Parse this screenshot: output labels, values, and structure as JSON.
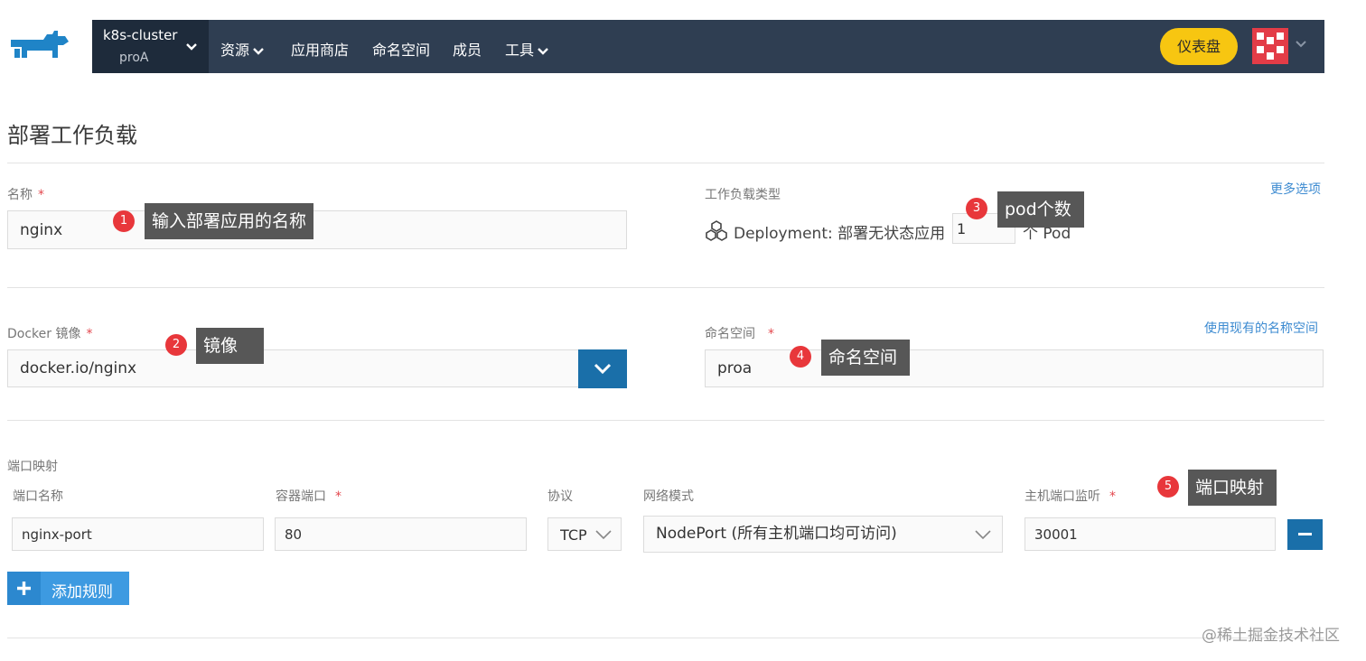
{
  "header": {
    "cluster_name": "k8s-cluster",
    "project_name": "proA",
    "nav": [
      "资源",
      "应用商店",
      "命名空间",
      "成员",
      "工具"
    ],
    "dashboard_label": "仪表盘"
  },
  "page": {
    "title": "部署工作负载"
  },
  "form": {
    "name_label": "名称",
    "name_value": "nginx",
    "workload_type_label": "工作负载类型",
    "more_options_link": "更多选项",
    "deployment_label": "Deployment: 部署无状态应用",
    "replicas_value": "1",
    "replicas_suffix": "个 Pod",
    "image_label": "Docker 镜像",
    "image_value": "docker.io/nginx",
    "namespace_label": "命名空间",
    "use_existing_link": "使用现有的名称空间",
    "namespace_value": "proa",
    "required_mark": "*"
  },
  "port_mapping": {
    "section_label": "端口映射",
    "columns": {
      "port_name": "端口名称",
      "container_port": "容器端口",
      "protocol": "协议",
      "network_mode": "网络模式",
      "host_port": "主机端口监听"
    },
    "row": {
      "port_name": "nginx-port",
      "container_port": "80",
      "protocol": "TCP",
      "network_mode": "NodePort (所有主机端口均可访问)",
      "host_port": "30001"
    },
    "add_rule_label": "添加规则"
  },
  "annotations": [
    {
      "number": "1",
      "text": "输入部署应用的名称"
    },
    {
      "number": "2",
      "text": "镜像"
    },
    {
      "number": "3",
      "text": "pod个数"
    },
    {
      "number": "4",
      "text": "命名空间"
    },
    {
      "number": "5",
      "text": "端口映射"
    }
  ],
  "watermark": "@稀土掘金技术社区",
  "colors": {
    "navbar": "#2f3e52",
    "cluster_bg": "#1e2b3b",
    "dashboard_button": "#f7c611",
    "primary_button": "#1a6fa9",
    "add_button": "#3d9ae1",
    "annotation_badge": "#e8373b",
    "annotation_tip": "#575757",
    "link": "#3d8bd1"
  }
}
